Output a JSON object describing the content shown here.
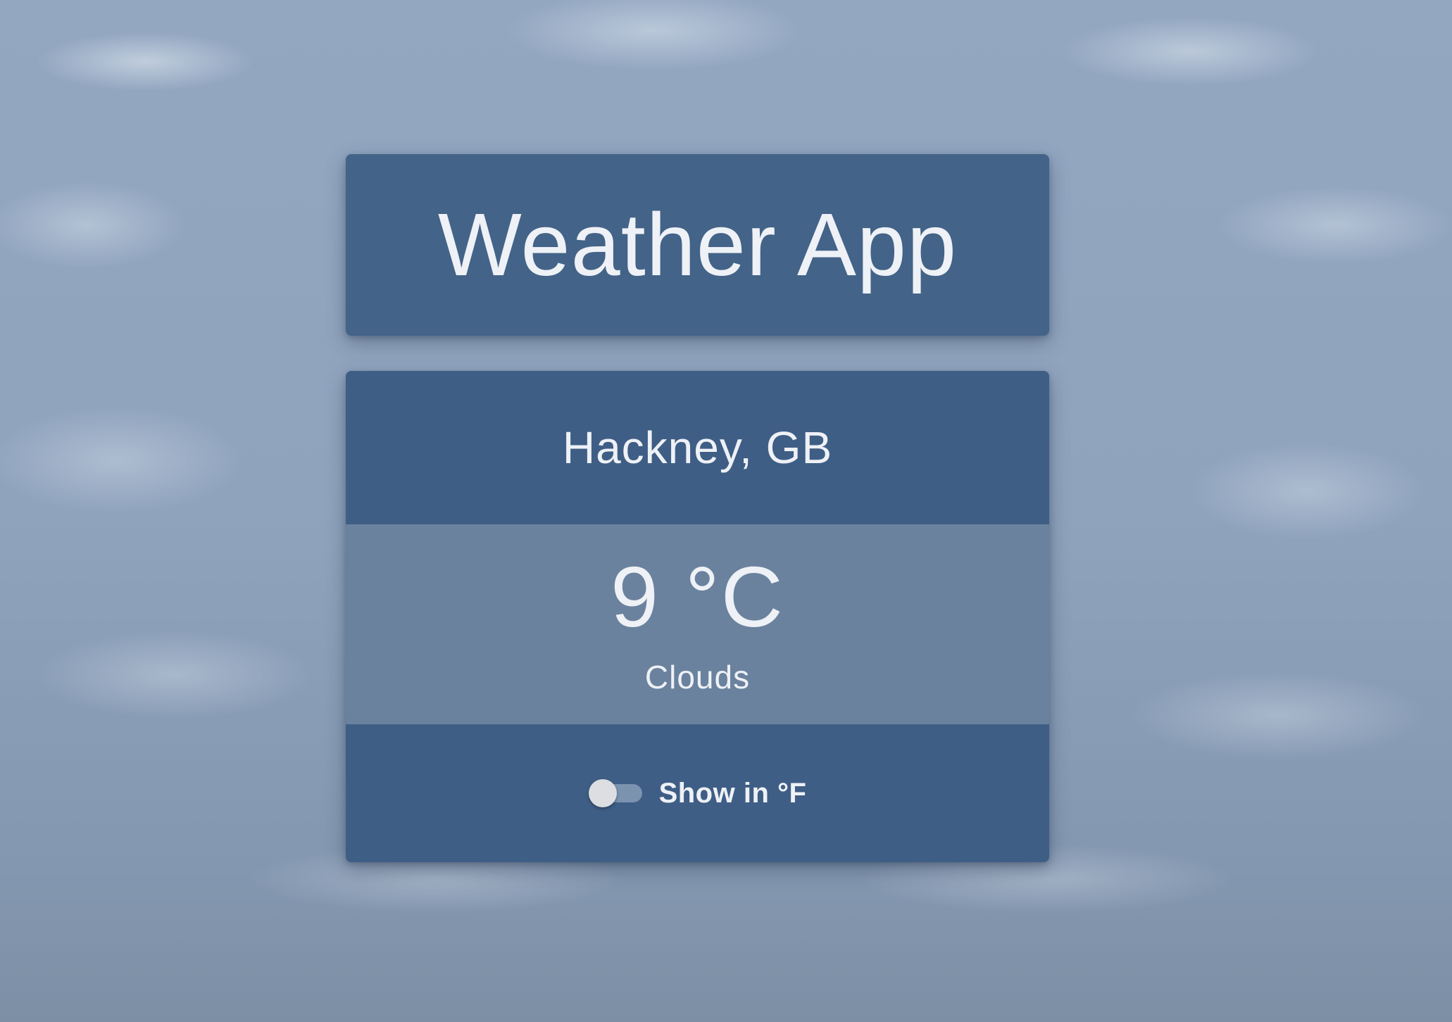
{
  "app": {
    "title": "Weather App"
  },
  "weather": {
    "location": "Hackney, GB",
    "temperature": "9 °C",
    "condition": "Clouds"
  },
  "unit_toggle": {
    "label": "Show in °F",
    "checked": false
  },
  "colors": {
    "card": "#3e5d84",
    "temperature_band": "#6a829e",
    "text": "#eef1f6"
  }
}
